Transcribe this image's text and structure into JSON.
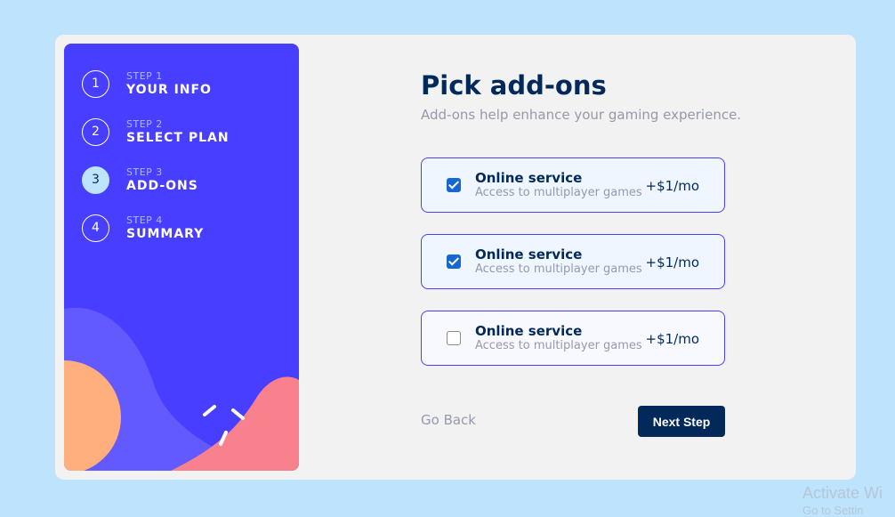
{
  "colors": {
    "page_bg": "#bee3fd",
    "sidebar_bg": "#483eff",
    "marine_blue": "#02295a",
    "cool_gray": "#9699ab",
    "purplish_blue": "#483eff",
    "light_blue": "#bee3fd"
  },
  "sidebar": {
    "steps": [
      {
        "number": "1",
        "label": "STEP 1",
        "title": "YOUR INFO"
      },
      {
        "number": "2",
        "label": "STEP 2",
        "title": "SELECT PLAN"
      },
      {
        "number": "3",
        "label": "STEP 3",
        "title": "ADD-ONS",
        "active": true
      },
      {
        "number": "4",
        "label": "STEP 4",
        "title": "SUMMARY"
      }
    ]
  },
  "main": {
    "title": "Pick add-ons",
    "subtitle": "Add-ons help enhance your gaming experience.",
    "addons": [
      {
        "name": "Online service",
        "description": "Access to multiplayer games",
        "price": "+$1/mo",
        "checked": true
      },
      {
        "name": "Online service",
        "description": "Access to multiplayer games",
        "price": "+$1/mo",
        "checked": true
      },
      {
        "name": "Online service",
        "description": "Access to multiplayer games",
        "price": "+$1/mo",
        "checked": false
      }
    ],
    "go_back": "Go Back",
    "next_step": "Next Step"
  },
  "watermark": {
    "line1": "Activate Wi",
    "line2": "Go to Settin"
  }
}
